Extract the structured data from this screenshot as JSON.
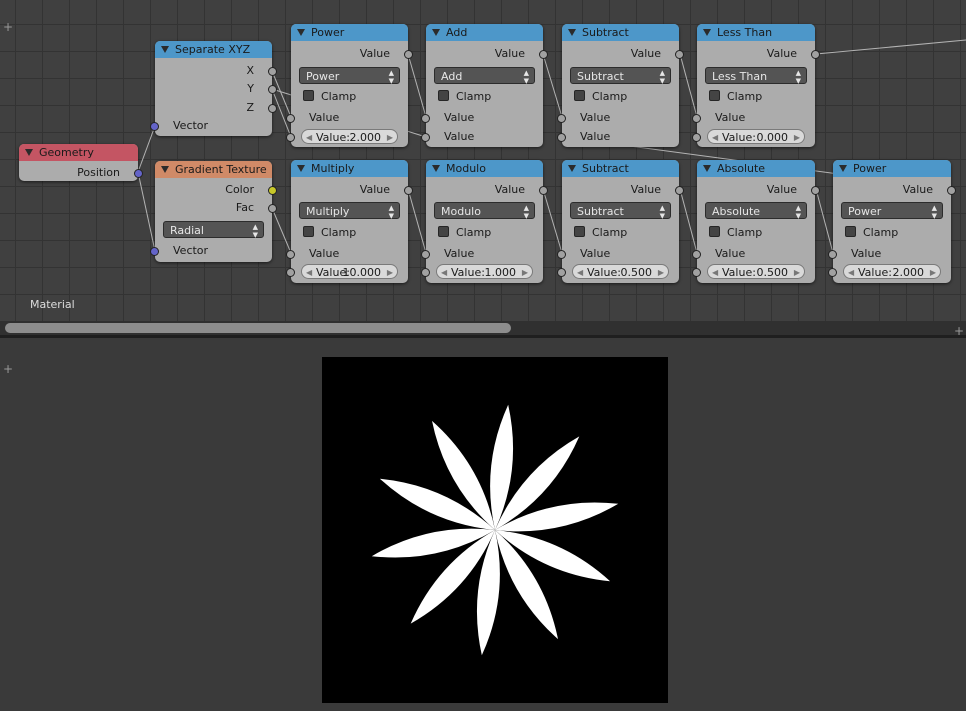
{
  "editor": {
    "tree_name": "Material"
  },
  "nodes": {
    "geometry": {
      "title": "Geometry",
      "out_position": "Position"
    },
    "separate_xyz": {
      "title": "Separate XYZ",
      "out_x": "X",
      "out_y": "Y",
      "out_z": "Z",
      "in_vector": "Vector"
    },
    "gradient_texture": {
      "title": "Gradient Texture",
      "out_color": "Color",
      "out_fac": "Fac",
      "type": "Radial",
      "in_vector": "Vector"
    },
    "power1": {
      "title": "Power",
      "out": "Value",
      "op": "Power",
      "clamp": "Clamp",
      "in1": "Value",
      "vlabel": "Value:",
      "v": "2.000"
    },
    "add": {
      "title": "Add",
      "out": "Value",
      "op": "Add",
      "clamp": "Clamp",
      "in1": "Value",
      "in2": "Value"
    },
    "subtract1": {
      "title": "Subtract",
      "out": "Value",
      "op": "Subtract",
      "clamp": "Clamp",
      "in1": "Value",
      "in2": "Value"
    },
    "lessthan": {
      "title": "Less Than",
      "out": "Value",
      "op": "Less Than",
      "clamp": "Clamp",
      "in1": "Value",
      "vlabel": "Value:",
      "v": "0.000"
    },
    "multiply": {
      "title": "Multiply",
      "out": "Value",
      "op": "Multiply",
      "clamp": "Clamp",
      "in1": "Value",
      "vlabel": "Value:",
      "v": "10.000"
    },
    "modulo": {
      "title": "Modulo",
      "out": "Value",
      "op": "Modulo",
      "clamp": "Clamp",
      "in1": "Value",
      "vlabel": "Value:",
      "v": "1.000"
    },
    "subtract2": {
      "title": "Subtract",
      "out": "Value",
      "op": "Subtract",
      "clamp": "Clamp",
      "in1": "Value",
      "vlabel": "Value:",
      "v": "0.500"
    },
    "absolute": {
      "title": "Absolute",
      "out": "Value",
      "op": "Absolute",
      "clamp": "Clamp",
      "in1": "Value",
      "vlabel": "Value:",
      "v": "0.500"
    },
    "power2": {
      "title": "Power",
      "out": "Value",
      "op": "Power",
      "clamp": "Clamp",
      "in1": "Value",
      "vlabel": "Value:",
      "v": "2.000"
    }
  },
  "colors": {
    "header_math": "#4d97c9",
    "header_input": "#c45563",
    "header_texture": "#d08a67",
    "socket_vector": "#6464c8",
    "socket_color": "#c7c729"
  },
  "render": {
    "petals": 10
  }
}
